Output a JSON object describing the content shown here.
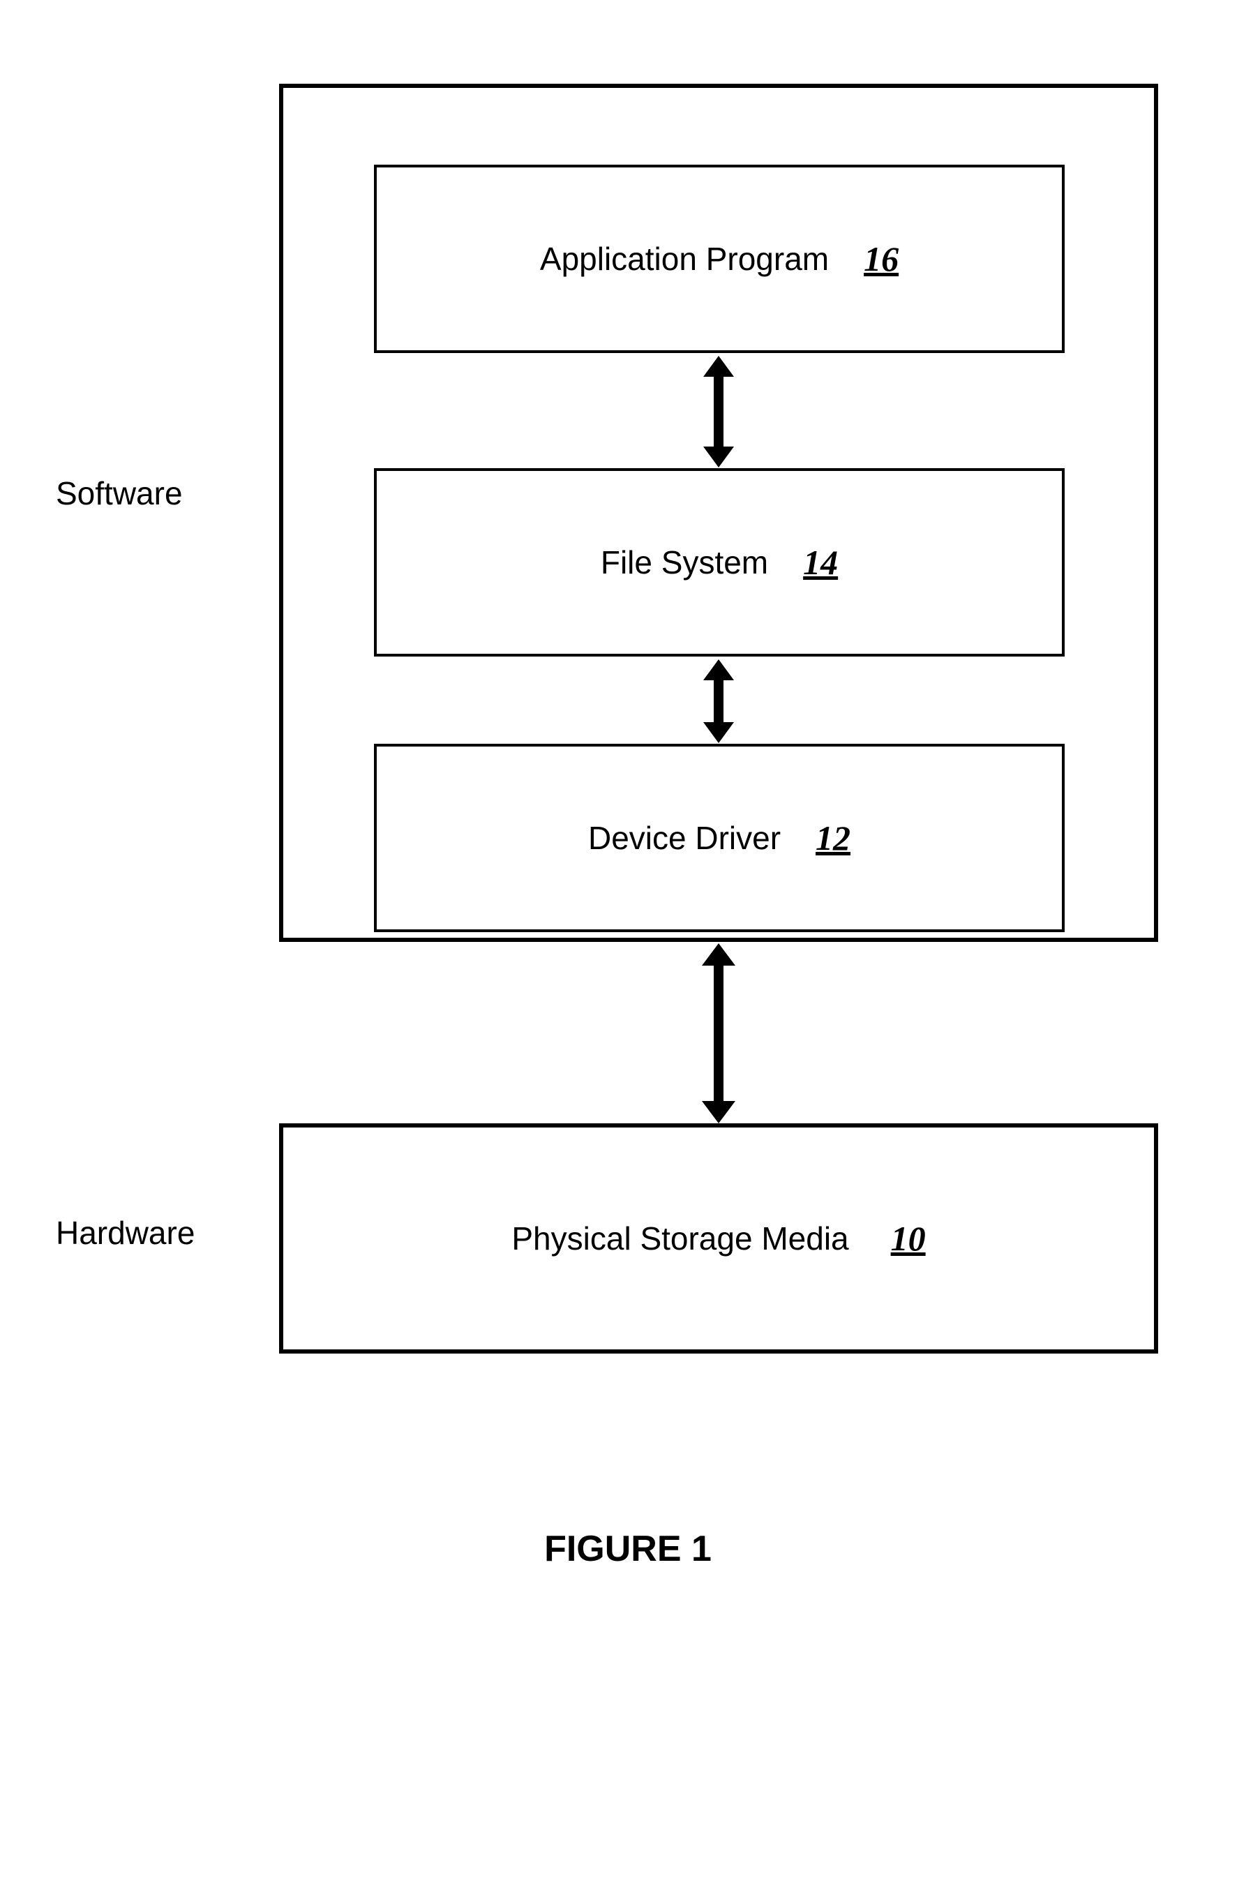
{
  "labels": {
    "software": "Software",
    "hardware": "Hardware"
  },
  "boxes": {
    "application": {
      "label": "Application Program",
      "ref": "16"
    },
    "filesystem": {
      "label": "File System",
      "ref": "14"
    },
    "driver": {
      "label": "Device Driver",
      "ref": "12"
    },
    "storage": {
      "label": "Physical Storage Media",
      "ref": "10"
    }
  },
  "caption": "FIGURE 1"
}
